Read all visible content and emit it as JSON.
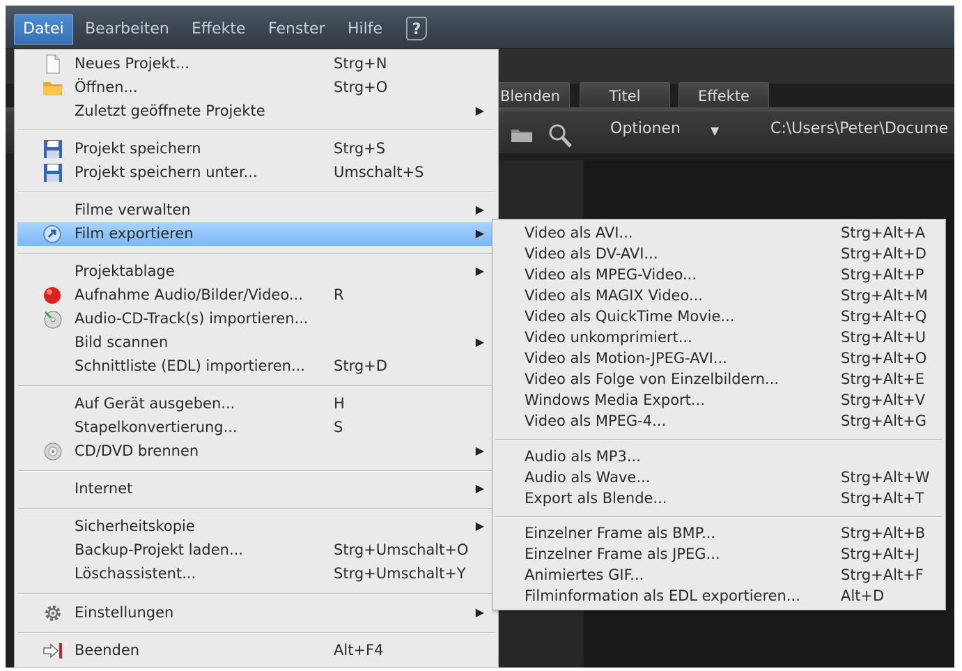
{
  "menubar": {
    "items": [
      "Datei",
      "Bearbeiten",
      "Effekte",
      "Fenster",
      "Hilfe"
    ],
    "help_icon": "help-icon"
  },
  "background": {
    "tabs": [
      "Blenden",
      "Titel",
      "Effekte"
    ],
    "options_label": "Optionen",
    "path": "C:\\Users\\Peter\\Docume"
  },
  "file_menu": {
    "items": [
      {
        "label": "Neues Projekt...",
        "shortcut": "Strg+N",
        "icon": "new-document-icon"
      },
      {
        "label": "Öffnen...",
        "shortcut": "Strg+O",
        "icon": "folder-icon"
      },
      {
        "label": "Zuletzt geöffnete Projekte",
        "shortcut": "",
        "submenu": true
      },
      {
        "label": "Projekt speichern",
        "shortcut": "Strg+S",
        "icon": "save-icon"
      },
      {
        "label": "Projekt speichern unter...",
        "shortcut": "Umschalt+S",
        "icon": "save-as-icon"
      },
      {
        "label": "Filme verwalten",
        "shortcut": "",
        "submenu": true
      },
      {
        "label": "Film exportieren",
        "shortcut": "",
        "submenu": true,
        "icon": "export-icon",
        "highlighted": true
      },
      {
        "label": "Projektablage",
        "shortcut": "",
        "submenu": true
      },
      {
        "label": "Aufnahme Audio/Bilder/Video...",
        "shortcut": "R",
        "icon": "record-icon"
      },
      {
        "label": "Audio-CD-Track(s) importieren...",
        "shortcut": "",
        "icon": "audio-cd-icon"
      },
      {
        "label": "Bild scannen",
        "shortcut": "",
        "submenu": true
      },
      {
        "label": "Schnittliste (EDL) importieren...",
        "shortcut": "Strg+D"
      },
      {
        "label": "Auf Gerät ausgeben...",
        "shortcut": "H"
      },
      {
        "label": "Stapelkonvertierung...",
        "shortcut": "S"
      },
      {
        "label": "CD/DVD brennen",
        "shortcut": "",
        "submenu": true,
        "icon": "disc-icon"
      },
      {
        "label": "Internet",
        "shortcut": "",
        "submenu": true
      },
      {
        "label": "Sicherheitskopie",
        "shortcut": "",
        "submenu": true
      },
      {
        "label": "Backup-Projekt laden...",
        "shortcut": "Strg+Umschalt+O"
      },
      {
        "label": "Löschassistent...",
        "shortcut": "Strg+Umschalt+Y"
      },
      {
        "label": "Einstellungen",
        "shortcut": "",
        "submenu": true,
        "icon": "gear-icon"
      },
      {
        "label": "Beenden",
        "shortcut": "Alt+F4",
        "icon": "exit-icon"
      }
    ]
  },
  "export_submenu": {
    "items": [
      {
        "label": "Video als AVI...",
        "shortcut": "Strg+Alt+A"
      },
      {
        "label": "Video als DV-AVI...",
        "shortcut": "Strg+Alt+D"
      },
      {
        "label": "Video als MPEG-Video...",
        "shortcut": "Strg+Alt+P"
      },
      {
        "label": "Video als MAGIX Video...",
        "shortcut": "Strg+Alt+M"
      },
      {
        "label": "Video als QuickTime Movie...",
        "shortcut": "Strg+Alt+Q"
      },
      {
        "label": "Video unkomprimiert...",
        "shortcut": "Strg+Alt+U"
      },
      {
        "label": "Video als Motion-JPEG-AVI...",
        "shortcut": "Strg+Alt+O"
      },
      {
        "label": "Video als Folge von Einzelbildern...",
        "shortcut": "Strg+Alt+E"
      },
      {
        "label": "Windows Media Export...",
        "shortcut": "Strg+Alt+V"
      },
      {
        "label": "Video als MPEG-4...",
        "shortcut": "Strg+Alt+G"
      },
      {
        "label": "Audio als MP3...",
        "shortcut": ""
      },
      {
        "label": "Audio als Wave...",
        "shortcut": "Strg+Alt+W"
      },
      {
        "label": "Export als Blende...",
        "shortcut": "Strg+Alt+T"
      },
      {
        "label": "Einzelner Frame als BMP...",
        "shortcut": "Strg+Alt+B"
      },
      {
        "label": "Einzelner Frame als JPEG...",
        "shortcut": "Strg+Alt+J"
      },
      {
        "label": "Animiertes GIF...",
        "shortcut": "Strg+Alt+F"
      },
      {
        "label": "Filminformation als EDL exportieren...",
        "shortcut": "Alt+D"
      }
    ]
  }
}
